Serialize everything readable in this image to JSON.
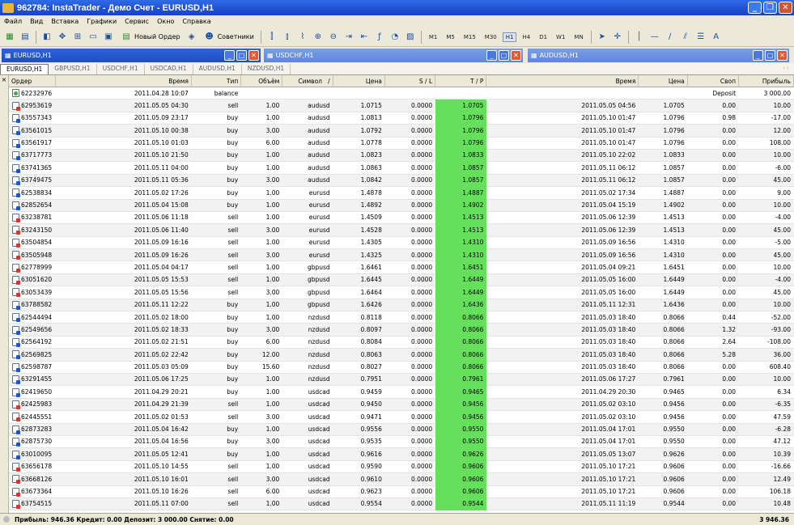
{
  "window": {
    "title": "962784: InstaTrader - Демо Счет - EURUSD,H1"
  },
  "menu": [
    "Файл",
    "Вид",
    "Вставка",
    "Графики",
    "Сервис",
    "Окно",
    "Справка"
  ],
  "toolbar": {
    "new_order_label": "Новый Ордер",
    "experts_label": "Советники",
    "timeframes": [
      "M1",
      "M5",
      "M15",
      "M30",
      "H1",
      "H4",
      "D1",
      "W1",
      "MN"
    ],
    "active_timeframe": "H1"
  },
  "chart_windows": [
    "EURUSD,H1",
    "USDCHF,H1",
    "AUDUSD,H1"
  ],
  "tabs": [
    "EURUSD,H1",
    "GBPUSD,H1",
    "USDCHF,H1",
    "USDCAD,H1",
    "AUDUSD,H1",
    "NZDUSD,H1"
  ],
  "tabs_arrows": "‹ ›",
  "columns": [
    "Ордер",
    "Время",
    "Тип",
    "Объём",
    "Символ",
    "Цена",
    "S / L",
    "T / P",
    "Время",
    "Цена",
    "Своп",
    "Прибыль"
  ],
  "sort_indicator": "/",
  "rows": [
    [
      "62232976",
      "2011.04.28 10:07",
      "balance",
      "",
      "",
      "",
      "",
      "",
      "",
      "",
      "Deposit",
      "3 000.00"
    ],
    [
      "62953619",
      "2011.05.05 04:30",
      "sell",
      "1.00",
      "audusd",
      "1.0715",
      "0.0000",
      "1.0705",
      "2011.05.05 04:56",
      "1.0705",
      "0.00",
      "10.00"
    ],
    [
      "63557343",
      "2011.05.09 23:17",
      "buy",
      "1.00",
      "audusd",
      "1.0813",
      "0.0000",
      "1.0796",
      "2011.05.10 01:47",
      "1.0796",
      "0.98",
      "-17.00"
    ],
    [
      "63561015",
      "2011.05.10 00:38",
      "buy",
      "3.00",
      "audusd",
      "1.0792",
      "0.0000",
      "1.0796",
      "2011.05.10 01:47",
      "1.0796",
      "0.00",
      "12.00"
    ],
    [
      "63561917",
      "2011.05.10 01:03",
      "buy",
      "6.00",
      "audusd",
      "1.0778",
      "0.0000",
      "1.0796",
      "2011.05.10 01:47",
      "1.0796",
      "0.00",
      "108.00"
    ],
    [
      "63717773",
      "2011.05.10 21:50",
      "buy",
      "1.00",
      "audusd",
      "1.0823",
      "0.0000",
      "1.0833",
      "2011.05.10 22:02",
      "1.0833",
      "0.00",
      "10.00"
    ],
    [
      "63741365",
      "2011.05.11 04:00",
      "buy",
      "1.00",
      "audusd",
      "1.0863",
      "0.0000",
      "1.0857",
      "2011.05.11 06:12",
      "1.0857",
      "0.00",
      "-6.00"
    ],
    [
      "63749475",
      "2011.05.11 05:36",
      "buy",
      "3.00",
      "audusd",
      "1.0842",
      "0.0000",
      "1.0857",
      "2011.05.11 06:12",
      "1.0857",
      "0.00",
      "45.00"
    ],
    [
      "62538834",
      "2011.05.02 17:26",
      "buy",
      "1.00",
      "eurusd",
      "1.4878",
      "0.0000",
      "1.4887",
      "2011.05.02 17:34",
      "1.4887",
      "0.00",
      "9.00"
    ],
    [
      "62852654",
      "2011.05.04 15:08",
      "buy",
      "1.00",
      "eurusd",
      "1.4892",
      "0.0000",
      "1.4902",
      "2011.05.04 15:19",
      "1.4902",
      "0.00",
      "10.00"
    ],
    [
      "63238781",
      "2011.05.06 11:18",
      "sell",
      "1.00",
      "eurusd",
      "1.4509",
      "0.0000",
      "1.4513",
      "2011.05.06 12:39",
      "1.4513",
      "0.00",
      "-4.00"
    ],
    [
      "63243150",
      "2011.05.06 11:40",
      "sell",
      "3.00",
      "eurusd",
      "1.4528",
      "0.0000",
      "1.4513",
      "2011.05.06 12:39",
      "1.4513",
      "0.00",
      "45.00"
    ],
    [
      "63504854",
      "2011.05.09 16:16",
      "sell",
      "1.00",
      "eurusd",
      "1.4305",
      "0.0000",
      "1.4310",
      "2011.05.09 16:56",
      "1.4310",
      "0.00",
      "-5.00"
    ],
    [
      "63505948",
      "2011.05.09 16:26",
      "sell",
      "3.00",
      "eurusd",
      "1.4325",
      "0.0000",
      "1.4310",
      "2011.05.09 16:56",
      "1.4310",
      "0.00",
      "45.00"
    ],
    [
      "62778999",
      "2011.05.04 04:17",
      "sell",
      "1.00",
      "gbpusd",
      "1.6461",
      "0.0000",
      "1.6451",
      "2011.05.04 09:21",
      "1.6451",
      "0.00",
      "10.00"
    ],
    [
      "63051620",
      "2011.05.05 15:53",
      "sell",
      "1.00",
      "gbpusd",
      "1.6445",
      "0.0000",
      "1.6449",
      "2011.05.05 16:00",
      "1.6449",
      "0.00",
      "-4.00"
    ],
    [
      "63053439",
      "2011.05.05 15:56",
      "sell",
      "3.00",
      "gbpusd",
      "1.6464",
      "0.0000",
      "1.6449",
      "2011.05.05 16:00",
      "1.6449",
      "0.00",
      "45.00"
    ],
    [
      "63788582",
      "2011.05.11 12:22",
      "buy",
      "1.00",
      "gbpusd",
      "1.6426",
      "0.0000",
      "1.6436",
      "2011.05.11 12:31",
      "1.6436",
      "0.00",
      "10.00"
    ],
    [
      "62544494",
      "2011.05.02 18:00",
      "buy",
      "1.00",
      "nzdusd",
      "0.8118",
      "0.0000",
      "0.8066",
      "2011.05.03 18:40",
      "0.8066",
      "0.44",
      "-52.00"
    ],
    [
      "62549656",
      "2011.05.02 18:33",
      "buy",
      "3.00",
      "nzdusd",
      "0.8097",
      "0.0000",
      "0.8066",
      "2011.05.03 18:40",
      "0.8066",
      "1.32",
      "-93.00"
    ],
    [
      "62564192",
      "2011.05.02 21:51",
      "buy",
      "6.00",
      "nzdusd",
      "0.8084",
      "0.0000",
      "0.8066",
      "2011.05.03 18:40",
      "0.8066",
      "2.64",
      "-108.00"
    ],
    [
      "62569825",
      "2011.05.02 22:42",
      "buy",
      "12.00",
      "nzdusd",
      "0.8063",
      "0.0000",
      "0.8066",
      "2011.05.03 18:40",
      "0.8066",
      "5.28",
      "36.00"
    ],
    [
      "62598787",
      "2011.05.03 05:09",
      "buy",
      "15.60",
      "nzdusd",
      "0.8027",
      "0.0000",
      "0.8066",
      "2011.05.03 18:40",
      "0.8066",
      "0.00",
      "608.40"
    ],
    [
      "63291455",
      "2011.05.06 17:25",
      "buy",
      "1.00",
      "nzdusd",
      "0.7951",
      "0.0000",
      "0.7961",
      "2011.05.06 17:27",
      "0.7961",
      "0.00",
      "10.00"
    ],
    [
      "62419650",
      "2011.04.29 20:21",
      "buy",
      "1.00",
      "usdcad",
      "0.9459",
      "0.0000",
      "0.9465",
      "2011.04.29 20:30",
      "0.9465",
      "0.00",
      "6.34"
    ],
    [
      "62425983",
      "2011.04.29 21:39",
      "sell",
      "1.00",
      "usdcad",
      "0.9450",
      "0.0000",
      "0.9456",
      "2011.05.02 03:10",
      "0.9456",
      "0.00",
      "-6.35"
    ],
    [
      "62445551",
      "2011.05.02 01:53",
      "sell",
      "3.00",
      "usdcad",
      "0.9471",
      "0.0000",
      "0.9456",
      "2011.05.02 03:10",
      "0.9456",
      "0.00",
      "47.59"
    ],
    [
      "62873283",
      "2011.05.04 16:42",
      "buy",
      "1.00",
      "usdcad",
      "0.9556",
      "0.0000",
      "0.9550",
      "2011.05.04 17:01",
      "0.9550",
      "0.00",
      "-6.28"
    ],
    [
      "62875730",
      "2011.05.04 16:56",
      "buy",
      "3.00",
      "usdcad",
      "0.9535",
      "0.0000",
      "0.9550",
      "2011.05.04 17:01",
      "0.9550",
      "0.00",
      "47.12"
    ],
    [
      "63010095",
      "2011.05.05 12:41",
      "buy",
      "1.00",
      "usdcad",
      "0.9616",
      "0.0000",
      "0.9626",
      "2011.05.05 13:07",
      "0.9626",
      "0.00",
      "10.39"
    ],
    [
      "63656178",
      "2011.05.10 14:55",
      "sell",
      "1.00",
      "usdcad",
      "0.9590",
      "0.0000",
      "0.9606",
      "2011.05.10 17:21",
      "0.9606",
      "0.00",
      "-16.66"
    ],
    [
      "63668126",
      "2011.05.10 16:01",
      "sell",
      "3.00",
      "usdcad",
      "0.9610",
      "0.0000",
      "0.9606",
      "2011.05.10 17:21",
      "0.9606",
      "0.00",
      "12.49"
    ],
    [
      "63673364",
      "2011.05.10 16:26",
      "sell",
      "6.00",
      "usdcad",
      "0.9623",
      "0.0000",
      "0.9606",
      "2011.05.10 17:21",
      "0.9606",
      "0.00",
      "106.18"
    ],
    [
      "63754515",
      "2011.05.11 07:00",
      "sell",
      "1.00",
      "usdcad",
      "0.9554",
      "0.0000",
      "0.9544",
      "2011.05.11 11:19",
      "0.9544",
      "0.00",
      "10.48"
    ]
  ],
  "footer": {
    "summary": "Прибыль: 946.36  Кредит: 0.00  Депозит: 3 000.00  Снятие: 0.00",
    "total": "3 946.36"
  },
  "colors": {
    "tp_highlight": "#66e05c",
    "title_bar": "#1e4fd0",
    "chrome": "#ece9d8"
  }
}
